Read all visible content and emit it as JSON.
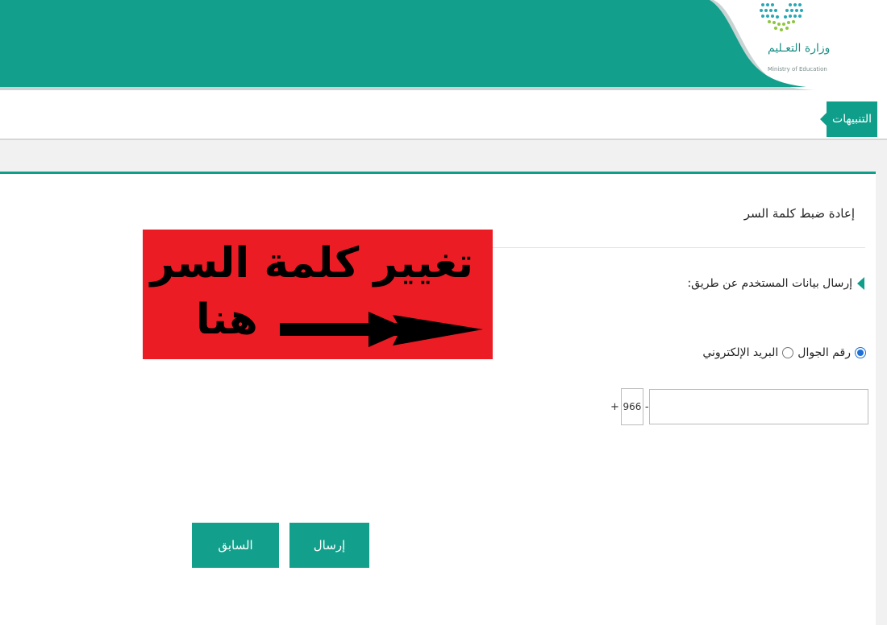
{
  "header": {
    "logo_ar": "وزارة التعـليم",
    "logo_en": "Ministry of Education",
    "logo_icon": "ministry-dots-logo-icon",
    "accent": "#0f9e8a"
  },
  "alerts": {
    "label": "التنبيهات"
  },
  "panel": {
    "title": "إعادة ضبط كلمة السر",
    "method_label": "إرسال بيانات المستخدم عن طريق:",
    "options": [
      {
        "label": "رقم الجوال",
        "selected": true
      },
      {
        "label": "البريد الإلكتروني",
        "selected": false
      }
    ],
    "phone": {
      "prefix": "+",
      "country_code": "966",
      "separator": "-",
      "value": "",
      "placeholder": ""
    },
    "buttons": {
      "send": "إرسال",
      "previous": "السابق"
    }
  },
  "banner": {
    "line1": "تغيير كلمة السر",
    "line2": "هنا",
    "color": "#ec1c24",
    "icon": "right-arrow-icon"
  }
}
